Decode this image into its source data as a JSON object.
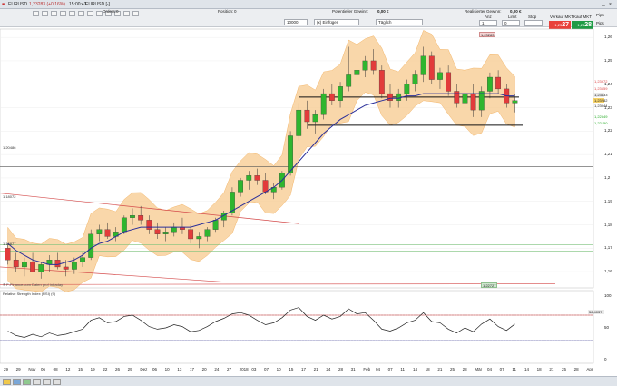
{
  "window": {
    "title": "EURUSD",
    "price": "1,23283 (+0,16%)",
    "time": "15:00:41",
    "timeframe": "EURUSD [-]"
  },
  "header": {
    "orders_label": "Orders:",
    "orders_value": "0",
    "position_label": "Position:",
    "position_value": "0",
    "pl_label": "Potentieller Gewinn:",
    "pl_value": "0,00 €",
    "realized_label": "Realisierter Gewinn:",
    "realized_value": "0,00 €",
    "quantity": "10000",
    "order_type": "(x) Einfügen",
    "validity": "Täglich",
    "col_anz": "Anz",
    "col_limit": "Limit",
    "col_stop": "Stop",
    "anz_value": "1",
    "limit_value": "0",
    "sell_label": "Verkauf MKT",
    "buy_label": "Kauf MKT",
    "sell_price": "27",
    "sell_prefix": "1,23",
    "buy_price": "28",
    "buy_prefix": "1,23",
    "pips_label1": "Pips",
    "pips_label2": "Pips"
  },
  "chart": {
    "panel_label": "Kurs",
    "info": "Jahr →Hoch 1,25569 ↙Tief 1,15155",
    "copyright": "® P-Finance.com  Daten pro! intraday",
    "rsi_label": "Relative Strength Index (RSI) (9)",
    "rsi_value": "56,4037",
    "level_labels": [
      "1,20486",
      "1,18072",
      "1,16877"
    ],
    "tag_top": "1,23283",
    "tag_bottom": "1,22727",
    "right_prices": [
      "1,23972",
      "1,23659",
      "1,23433",
      "1,23282",
      "1,23044",
      "1,22549",
      "1,22150"
    ]
  },
  "y_axis": [
    "1,26",
    "1,25",
    "1,24",
    "1,23",
    "1,22",
    "1,21",
    "1,2",
    "1,19",
    "1,18",
    "1,17",
    "1,16"
  ],
  "rsi_axis": [
    "100",
    "50",
    "0"
  ],
  "x_axis": [
    "29",
    "29",
    "Nov",
    "06",
    "08",
    "12",
    "15",
    "19",
    "22",
    "26",
    "29",
    "Dez",
    "06",
    "10",
    "13",
    "17",
    "20",
    "24",
    "27",
    "2018",
    "03",
    "07",
    "10",
    "15",
    "17",
    "21",
    "24",
    "28",
    "31",
    "Feb",
    "04",
    "07",
    "11",
    "14",
    "18",
    "21",
    "25",
    "28",
    "Mär",
    "04",
    "07",
    "11",
    "14",
    "18",
    "21",
    "25",
    "28",
    "Apr"
  ],
  "colors": {
    "up": "#2fb52f",
    "down": "#e23b3b",
    "band": "#f7c98e",
    "ma": "#2a2f9a",
    "support": "#7ac27a",
    "resistance": "#d44a4a"
  },
  "chart_data": {
    "type": "candlestick",
    "series_desc": "Daily candles, EURUSD",
    "y_range": [
      1.155,
      1.262
    ],
    "candles": [
      [
        1.17,
        1.172,
        1.163,
        1.165
      ],
      [
        1.165,
        1.168,
        1.16,
        1.162
      ],
      [
        1.162,
        1.166,
        1.158,
        1.164
      ],
      [
        1.164,
        1.168,
        1.161,
        1.16
      ],
      [
        1.16,
        1.164,
        1.157,
        1.163
      ],
      [
        1.163,
        1.167,
        1.16,
        1.165
      ],
      [
        1.165,
        1.168,
        1.161,
        1.162
      ],
      [
        1.162,
        1.165,
        1.158,
        1.161
      ],
      [
        1.161,
        1.166,
        1.159,
        1.164
      ],
      [
        1.164,
        1.168,
        1.162,
        1.166
      ],
      [
        1.166,
        1.178,
        1.165,
        1.176
      ],
      [
        1.176,
        1.18,
        1.173,
        1.178
      ],
      [
        1.178,
        1.181,
        1.174,
        1.175
      ],
      [
        1.175,
        1.179,
        1.173,
        1.177
      ],
      [
        1.177,
        1.184,
        1.176,
        1.183
      ],
      [
        1.183,
        1.187,
        1.18,
        1.184
      ],
      [
        1.184,
        1.188,
        1.18,
        1.182
      ],
      [
        1.182,
        1.184,
        1.176,
        1.178
      ],
      [
        1.178,
        1.181,
        1.174,
        1.176
      ],
      [
        1.176,
        1.179,
        1.173,
        1.177
      ],
      [
        1.177,
        1.181,
        1.175,
        1.179
      ],
      [
        1.179,
        1.183,
        1.176,
        1.178
      ],
      [
        1.178,
        1.18,
        1.172,
        1.174
      ],
      [
        1.174,
        1.177,
        1.17,
        1.175
      ],
      [
        1.175,
        1.179,
        1.173,
        1.178
      ],
      [
        1.178,
        1.183,
        1.177,
        1.182
      ],
      [
        1.182,
        1.186,
        1.179,
        1.185
      ],
      [
        1.185,
        1.196,
        1.184,
        1.194
      ],
      [
        1.194,
        1.2,
        1.192,
        1.199
      ],
      [
        1.199,
        1.203,
        1.195,
        1.201
      ],
      [
        1.201,
        1.204,
        1.197,
        1.199
      ],
      [
        1.199,
        1.202,
        1.193,
        1.194
      ],
      [
        1.194,
        1.198,
        1.191,
        1.196
      ],
      [
        1.196,
        1.203,
        1.195,
        1.202
      ],
      [
        1.202,
        1.22,
        1.201,
        1.218
      ],
      [
        1.218,
        1.232,
        1.216,
        1.229
      ],
      [
        1.229,
        1.233,
        1.221,
        1.224
      ],
      [
        1.224,
        1.229,
        1.219,
        1.227
      ],
      [
        1.227,
        1.238,
        1.225,
        1.236
      ],
      [
        1.236,
        1.24,
        1.231,
        1.233
      ],
      [
        1.233,
        1.241,
        1.23,
        1.239
      ],
      [
        1.239,
        1.256,
        1.237,
        1.244
      ],
      [
        1.244,
        1.248,
        1.238,
        1.246
      ],
      [
        1.246,
        1.252,
        1.243,
        1.25
      ],
      [
        1.25,
        1.255,
        1.244,
        1.246
      ],
      [
        1.246,
        1.248,
        1.234,
        1.236
      ],
      [
        1.236,
        1.24,
        1.23,
        1.233
      ],
      [
        1.233,
        1.238,
        1.23,
        1.236
      ],
      [
        1.236,
        1.242,
        1.233,
        1.24
      ],
      [
        1.24,
        1.246,
        1.237,
        1.244
      ],
      [
        1.244,
        1.256,
        1.241,
        1.252
      ],
      [
        1.252,
        1.254,
        1.24,
        1.242
      ],
      [
        1.242,
        1.247,
        1.238,
        1.245
      ],
      [
        1.245,
        1.248,
        1.235,
        1.237
      ],
      [
        1.237,
        1.24,
        1.23,
        1.232
      ],
      [
        1.232,
        1.238,
        1.228,
        1.236
      ],
      [
        1.236,
        1.24,
        1.226,
        1.229
      ],
      [
        1.229,
        1.239,
        1.226,
        1.237
      ],
      [
        1.237,
        1.245,
        1.234,
        1.243
      ],
      [
        1.243,
        1.246,
        1.236,
        1.238
      ],
      [
        1.238,
        1.24,
        1.23,
        1.232
      ],
      [
        1.232,
        1.236,
        1.228,
        1.233
      ]
    ],
    "ma": [
      1.172,
      1.169,
      1.167,
      1.165,
      1.164,
      1.163,
      1.163,
      1.164,
      1.165,
      1.167,
      1.17,
      1.172,
      1.173,
      1.175,
      1.177,
      1.178,
      1.179,
      1.179,
      1.179,
      1.179,
      1.179,
      1.179,
      1.179,
      1.18,
      1.181,
      1.182,
      1.184,
      1.186,
      1.188,
      1.19,
      1.192,
      1.194,
      1.196,
      1.199,
      1.203,
      1.207,
      1.211,
      1.215,
      1.219,
      1.222,
      1.225,
      1.227,
      1.229,
      1.231,
      1.232,
      1.233,
      1.234,
      1.234,
      1.235,
      1.235,
      1.236,
      1.236,
      1.236,
      1.236,
      1.236,
      1.236,
      1.236,
      1.236,
      1.236,
      1.236,
      1.235,
      1.235
    ],
    "rsi": [
      45,
      38,
      35,
      40,
      36,
      42,
      38,
      40,
      44,
      48,
      62,
      66,
      58,
      60,
      68,
      70,
      62,
      52,
      48,
      50,
      55,
      52,
      44,
      46,
      52,
      60,
      65,
      72,
      74,
      70,
      62,
      55,
      58,
      66,
      78,
      82,
      68,
      62,
      70,
      64,
      68,
      80,
      72,
      74,
      62,
      48,
      45,
      50,
      58,
      62,
      74,
      60,
      58,
      48,
      42,
      50,
      44,
      56,
      64,
      52,
      46,
      56
    ]
  }
}
